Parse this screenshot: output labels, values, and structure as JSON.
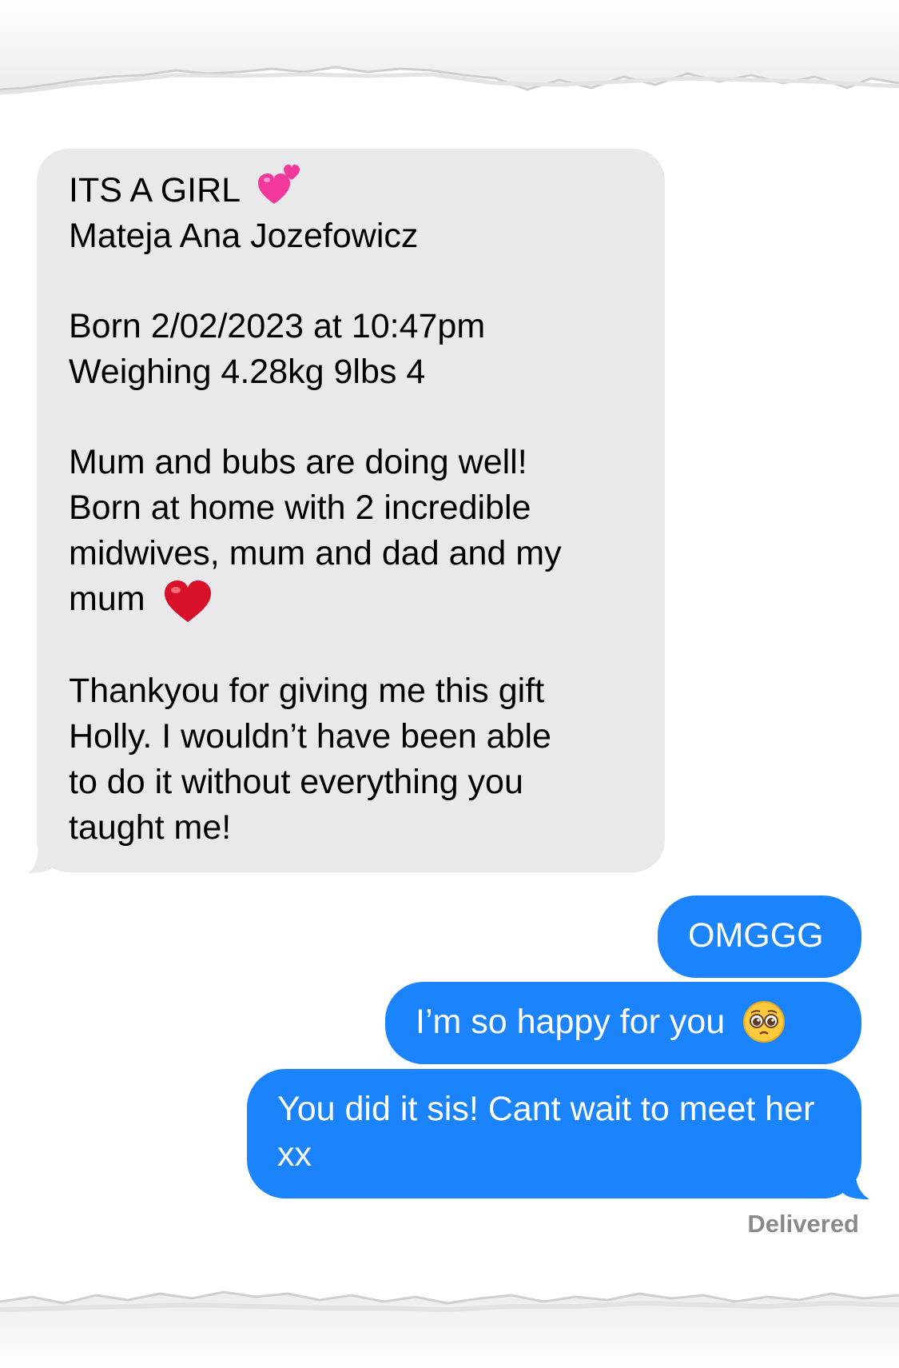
{
  "conversation": {
    "incoming": {
      "paragraphs": [
        [
          "ITS A GIRL",
          "Mateja Ana Jozefowicz"
        ],
        [
          "Born 2/02/2023 at 10:47pm",
          "Weighing 4.28kg 9lbs 4"
        ],
        [
          "Mum and bubs are doing well!",
          "Born at home with 2 incredible",
          "midwives, mum and dad and my",
          "mum"
        ],
        [
          "Thankyou for giving me this gift",
          "Holly. I wouldn’t have been able",
          "to do it without everything you",
          "taught me!"
        ]
      ],
      "emojis": {
        "line1": "two-hearts-icon",
        "mum_line": "red-heart-icon"
      }
    },
    "outgoing": [
      {
        "text": "OMGGG"
      },
      {
        "text": "I’m so happy for you",
        "emoji": "pleading-face-icon"
      },
      {
        "text": "You did it sis! Cant wait to meet her xx"
      }
    ],
    "status": "Delivered"
  },
  "colors": {
    "incoming_bg": "#e9e9eb",
    "outgoing_bg": "#1b84fd",
    "status_text": "#8a8a8e"
  }
}
